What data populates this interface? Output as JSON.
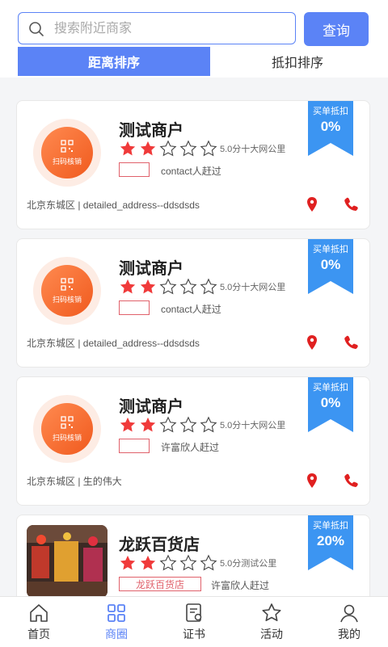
{
  "search": {
    "placeholder": "搜索附近商家",
    "button": "查询"
  },
  "tabs": [
    {
      "label": "距离排序",
      "active": true
    },
    {
      "label": "抵扣排序",
      "active": false
    }
  ],
  "colors": {
    "accent": "#5b83f6",
    "star": "#f03a3a",
    "ribbon": "#3c95f2",
    "icon_red": "#e02020"
  },
  "merchants": [
    {
      "name": "测试商户",
      "rating": 2,
      "score": "5.0分",
      "distance": "十大网公里",
      "logo_text": "扫码核销",
      "tag": "",
      "contact": "contact人赶过",
      "address": "北京东城区 | detailed_address--ddsdsds",
      "ribbon_title": "买单抵扣",
      "ribbon_value": "0%"
    },
    {
      "name": "测试商户",
      "rating": 2,
      "score": "5.0分",
      "distance": "十大网公里",
      "logo_text": "扫码核销",
      "tag": "",
      "contact": "contact人赶过",
      "address": "北京东城区 | detailed_address--ddsdsds",
      "ribbon_title": "买单抵扣",
      "ribbon_value": "0%"
    },
    {
      "name": "测试商户",
      "rating": 2,
      "score": "5.0分",
      "distance": "十大网公里",
      "logo_text": "扫码核销",
      "tag": "",
      "contact": "许富欣人赶过",
      "address": "北京东城区 | 生的伟大",
      "ribbon_title": "买单抵扣",
      "ribbon_value": "0%"
    },
    {
      "name": "龙跃百货店",
      "rating": 2,
      "score": "5.0分",
      "distance": "测试公里",
      "logo_text": "",
      "tag": "龙跃百货店",
      "contact": "许富欣人赶过",
      "address": "",
      "ribbon_title": "买单抵扣",
      "ribbon_value": "20%"
    }
  ],
  "nav": [
    {
      "label": "首页",
      "icon": "home-icon",
      "active": false
    },
    {
      "label": "商圈",
      "icon": "grid-icon",
      "active": true
    },
    {
      "label": "证书",
      "icon": "certificate-icon",
      "active": false
    },
    {
      "label": "活动",
      "icon": "star-icon",
      "active": false
    },
    {
      "label": "我的",
      "icon": "user-icon",
      "active": false
    }
  ]
}
